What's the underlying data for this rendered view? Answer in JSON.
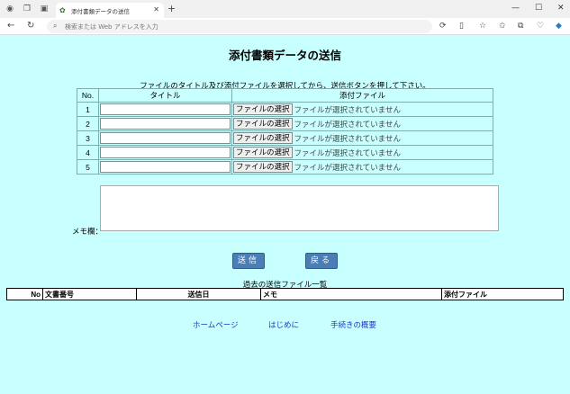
{
  "browser": {
    "tab_title": "添付書類データの送信",
    "address_placeholder": "検索または Web アドレスを入力"
  },
  "page": {
    "title": "添付書類データの送信",
    "instruction": "ファイルのタイトル及び添付ファイルを選択してから、送信ボタンを押して下さい。",
    "table_headers": {
      "no": "No.",
      "title": "タイトル",
      "file": "添付ファイル"
    },
    "rows": [
      {
        "no": "1",
        "title_value": "",
        "file_button": "ファイルの選択",
        "file_status": "ファイルが選択されていません"
      },
      {
        "no": "2",
        "title_value": "",
        "file_button": "ファイルの選択",
        "file_status": "ファイルが選択されていません"
      },
      {
        "no": "3",
        "title_value": "",
        "file_button": "ファイルの選択",
        "file_status": "ファイルが選択されていません"
      },
      {
        "no": "4",
        "title_value": "",
        "file_button": "ファイルの選択",
        "file_status": "ファイルが選択されていません"
      },
      {
        "no": "5",
        "title_value": "",
        "file_button": "ファイルの選択",
        "file_status": "ファイルが選択されていません"
      }
    ],
    "memo_label": "メモ欄：",
    "memo_value": "",
    "send_button": "送信",
    "back_button": "戻る",
    "history_caption": "過去の送信ファイル一覧",
    "history_headers": {
      "no": "No",
      "doc_no": "文書番号",
      "sent_date": "送信日",
      "memo": "メモ",
      "attachment": "添付ファイル"
    },
    "links": {
      "home": "ホームページ",
      "intro": "はじめに",
      "overview": "手続きの概要"
    }
  },
  "colors": {
    "background": "#c8ffff",
    "button": "#4a7eb5",
    "link": "#2233cc"
  }
}
